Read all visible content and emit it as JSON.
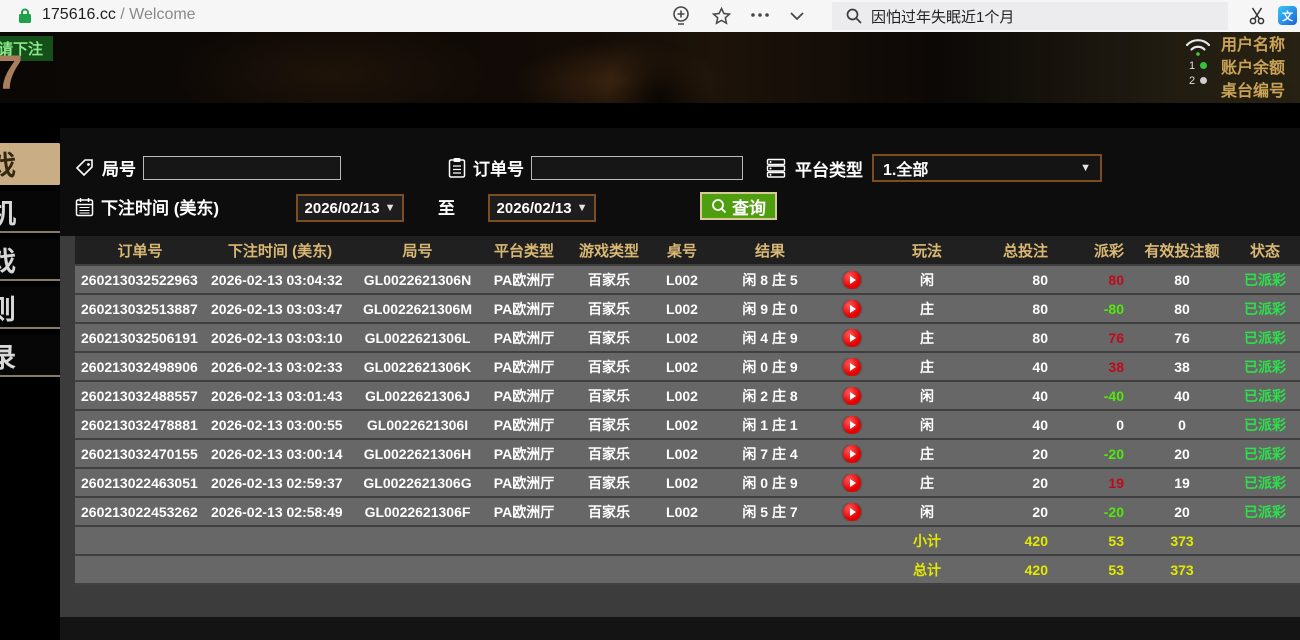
{
  "colors": {
    "status_green": "#2be04a",
    "payout_pos": "#c00a1c",
    "payout_neg": "#52e80e",
    "sum_yellow": "#e3ea00",
    "header_gold": "#d9b873",
    "query_green": "#4f9e10",
    "active_tab_tan": "#c9ae85"
  },
  "browser": {
    "url": "175616.cc",
    "url_suffix": " / Welcome",
    "search_text": "因怕过年失眠近1个月"
  },
  "scene": {
    "bet_banner": "请下注",
    "countdown": "7",
    "seat1": "1",
    "seat2": "2",
    "info_lines": [
      "用户名称",
      "账户余额",
      "桌台编号"
    ]
  },
  "sidebar": {
    "tabs": [
      {
        "label": "戏"
      },
      {
        "label": "机"
      },
      {
        "label": "戏"
      },
      {
        "label": "则"
      },
      {
        "label": "录"
      }
    ]
  },
  "filters": {
    "round_label": "局号",
    "order_label": "订单号",
    "platform_label": "平台类型",
    "platform_value": "1.全部",
    "time_label": "下注时间 (美东)",
    "date_from": "2026/02/13",
    "to_label": "至",
    "date_to": "2026/02/13",
    "query_label": "查询",
    "caret_down": "▼"
  },
  "table": {
    "headers": [
      "订单号",
      "下注时间 (美东)",
      "局号",
      "平台类型",
      "游戏类型",
      "桌号",
      "结果",
      "",
      "玩法",
      "总投注",
      "派彩",
      "有效投注额",
      "状态"
    ],
    "rows": [
      {
        "order_id": "260213032522963",
        "bet_time": "2026-02-13 03:04:32",
        "round_id": "GL0022621306N",
        "platform": "PA欧洲厅",
        "game_type": "百家乐",
        "table_no": "L002",
        "result": "闲 8 庄 5",
        "play_style": "闲",
        "total_bet": "80",
        "payout": "80",
        "payout_color": "#c00a1c",
        "valid_bet": "80",
        "status": "已派彩"
      },
      {
        "order_id": "260213032513887",
        "bet_time": "2026-02-13 03:03:47",
        "round_id": "GL0022621306M",
        "platform": "PA欧洲厅",
        "game_type": "百家乐",
        "table_no": "L002",
        "result": "闲 9 庄 0",
        "play_style": "庄",
        "total_bet": "80",
        "payout": "-80",
        "payout_color": "#52e80e",
        "valid_bet": "80",
        "status": "已派彩"
      },
      {
        "order_id": "260213032506191",
        "bet_time": "2026-02-13 03:03:10",
        "round_id": "GL0022621306L",
        "platform": "PA欧洲厅",
        "game_type": "百家乐",
        "table_no": "L002",
        "result": "闲 4 庄 9",
        "play_style": "庄",
        "total_bet": "80",
        "payout": "76",
        "payout_color": "#c00a1c",
        "valid_bet": "76",
        "status": "已派彩"
      },
      {
        "order_id": "260213032498906",
        "bet_time": "2026-02-13 03:02:33",
        "round_id": "GL0022621306K",
        "platform": "PA欧洲厅",
        "game_type": "百家乐",
        "table_no": "L002",
        "result": "闲 0 庄 9",
        "play_style": "庄",
        "total_bet": "40",
        "payout": "38",
        "payout_color": "#c00a1c",
        "valid_bet": "38",
        "status": "已派彩"
      },
      {
        "order_id": "260213032488557",
        "bet_time": "2026-02-13 03:01:43",
        "round_id": "GL0022621306J",
        "platform": "PA欧洲厅",
        "game_type": "百家乐",
        "table_no": "L002",
        "result": "闲 2 庄 8",
        "play_style": "闲",
        "total_bet": "40",
        "payout": "-40",
        "payout_color": "#52e80e",
        "valid_bet": "40",
        "status": "已派彩"
      },
      {
        "order_id": "260213032478881",
        "bet_time": "2026-02-13 03:00:55",
        "round_id": "GL0022621306I",
        "platform": "PA欧洲厅",
        "game_type": "百家乐",
        "table_no": "L002",
        "result": "闲 1 庄 1",
        "play_style": "闲",
        "total_bet": "40",
        "payout": "0",
        "payout_color": "#ffffff",
        "valid_bet": "0",
        "status": "已派彩"
      },
      {
        "order_id": "260213032470155",
        "bet_time": "2026-02-13 03:00:14",
        "round_id": "GL0022621306H",
        "platform": "PA欧洲厅",
        "game_type": "百家乐",
        "table_no": "L002",
        "result": "闲 7 庄 4",
        "play_style": "庄",
        "total_bet": "20",
        "payout": "-20",
        "payout_color": "#52e80e",
        "valid_bet": "20",
        "status": "已派彩"
      },
      {
        "order_id": "260213022463051",
        "bet_time": "2026-02-13 02:59:37",
        "round_id": "GL0022621306G",
        "platform": "PA欧洲厅",
        "game_type": "百家乐",
        "table_no": "L002",
        "result": "闲 0 庄 9",
        "play_style": "庄",
        "total_bet": "20",
        "payout": "19",
        "payout_color": "#c00a1c",
        "valid_bet": "19",
        "status": "已派彩"
      },
      {
        "order_id": "260213022453262",
        "bet_time": "2026-02-13 02:58:49",
        "round_id": "GL0022621306F",
        "platform": "PA欧洲厅",
        "game_type": "百家乐",
        "table_no": "L002",
        "result": "闲 5 庄 7",
        "play_style": "闲",
        "total_bet": "20",
        "payout": "-20",
        "payout_color": "#52e80e",
        "valid_bet": "20",
        "status": "已派彩"
      }
    ],
    "subtotal": {
      "label": "小计",
      "total_bet": "420",
      "payout": "53",
      "valid_bet": "373"
    },
    "total": {
      "label": "总计",
      "total_bet": "420",
      "payout": "53",
      "valid_bet": "373"
    }
  }
}
